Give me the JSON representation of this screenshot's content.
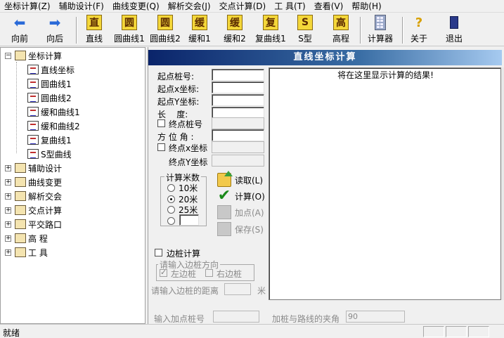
{
  "menubar": {
    "items": [
      "坐标计算(Z)",
      "辅助设计(F)",
      "曲线变更(Q)",
      "解析交会(J)",
      "交点计算(D)",
      "工 具(T)",
      "查看(V)",
      "帮助(H)"
    ]
  },
  "toolbar": {
    "buttons": [
      {
        "label": "向前",
        "icon": "back-arrow-icon"
      },
      {
        "label": "向后",
        "icon": "forward-arrow-icon"
      },
      {
        "label": "直线",
        "glyph": "直"
      },
      {
        "label": "圆曲线1",
        "glyph": "圆"
      },
      {
        "label": "圆曲线2",
        "glyph": "圆"
      },
      {
        "label": "缓和1",
        "glyph": "缓"
      },
      {
        "label": "缓和2",
        "glyph": "缓"
      },
      {
        "label": "复曲线1",
        "glyph": "复"
      },
      {
        "label": "S型",
        "glyph": "S"
      },
      {
        "label": "高程",
        "glyph": "高"
      },
      {
        "label": "计算器",
        "icon": "calculator-icon"
      },
      {
        "label": "关于",
        "icon": "about-icon"
      },
      {
        "label": "退出",
        "icon": "exit-icon"
      }
    ]
  },
  "tree": {
    "root": "坐标计算",
    "children": [
      "直线坐标",
      "圆曲线1",
      "圆曲线2",
      "缓和曲线1",
      "缓和曲线2",
      "复曲线1",
      "S型曲线"
    ],
    "others": [
      "辅助设计",
      "曲线变更",
      "解析交会",
      "交点计算",
      "平交路口",
      "高 程",
      "工 具"
    ],
    "expand_collapsed": "+",
    "expand_open": "−"
  },
  "panel": {
    "title": "直线坐标计算",
    "fields": {
      "start_station": "起点桩号:",
      "start_x": "起点x坐标:",
      "start_y": "起点Y坐标:",
      "length": "长    度:",
      "end_station": "终点桩号",
      "azimuth": "方 位 角 :",
      "end_x": "终点x坐标",
      "end_y": "终点Y坐标"
    },
    "meters_group": {
      "title": "计算米数",
      "options": [
        "10米",
        "20米",
        "25米"
      ],
      "selected_index": 1
    },
    "actions": {
      "read": "读取(L)",
      "calc": "计算(O)",
      "add": "加点(A)",
      "save": "保存(S)"
    },
    "side_stake": {
      "checkbox": "边桩计算",
      "direction_group": "请输入边桩方向",
      "left": "左边桩",
      "right": "右边桩",
      "distance_label": "请输入边桩的距离",
      "unit": "米"
    },
    "result_text": "将在这里显示计算的结果!",
    "add_point_label": "输入加点桩号",
    "angle_label": "加桩与路线的夹角",
    "angle_value": "90"
  },
  "statusbar": {
    "text": "就绪"
  }
}
